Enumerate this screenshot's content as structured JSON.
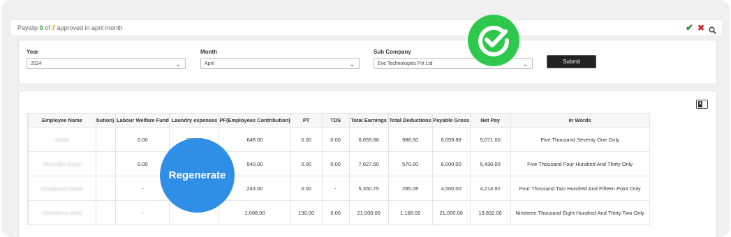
{
  "status_bar": {
    "prefix": "Payslip",
    "approved_count": "0",
    "of_text": "of",
    "total_count": "7",
    "suffix": "approved in april month"
  },
  "icons": {
    "approve": "check-icon",
    "reject": "close-icon",
    "search": "search-icon",
    "export": "excel-icon"
  },
  "filters": {
    "year": {
      "label": "Year",
      "value": "2024"
    },
    "month": {
      "label": "Month",
      "value": "April"
    },
    "sub_company": {
      "label": "Sub Company",
      "value": "Eve Technologies Pvt Ltd"
    },
    "submit_label": "Submit"
  },
  "table": {
    "columns": [
      "",
      "Employee Name",
      "bution)",
      "Labour Welfare Fund",
      "Laundry expenses",
      "PF(Employees Contribution)",
      "PT",
      "TDS",
      "Total Earnings",
      "Total Deductions",
      "Payable Gross",
      "Net Pay",
      "In Words"
    ],
    "rows": [
      [
        "",
        "Ankita",
        "",
        "0.00",
        "300.00",
        "648.00",
        "0.00",
        "0.00",
        "6,059.88",
        "988.50",
        "6,059.88",
        "5,071.00",
        "Five Thousand Seventy One Only"
      ],
      [
        "",
        "Anuradha Gupta",
        "",
        "0.00",
        "",
        "540.00",
        "0.00",
        "0.00",
        "7,027.50",
        "570.00",
        "6,000.00",
        "5,430.00",
        "Five Thousand Four Hundred And Thirty Only"
      ],
      [
        "",
        "Biswapriya Haldar",
        "",
        "-",
        "",
        "243.00",
        "0.00",
        "-",
        "5,350.75",
        "285.08",
        "4,500.00",
        "4,214.92",
        "Four Thousand Two Hundred And Fifteen Point Only"
      ],
      [
        "",
        "Chandrima Saha",
        "",
        "-",
        "",
        "1,008.00",
        "130.00",
        "0.00",
        "21,000.00",
        "1,168.00",
        "21,000.00",
        "19,832.00",
        "Nineteen Thousand Eight Hundred And Thirty Two Only"
      ]
    ]
  },
  "overlays": {
    "success_badge_icon": "check-circle-icon",
    "regenerate_label": "Regenerate"
  },
  "colors": {
    "success_green": "#2ec84c",
    "regenerate_blue": "#2f8ee6",
    "approved_count_color": "#2a9d2a",
    "total_count_color": "#e6a100"
  }
}
